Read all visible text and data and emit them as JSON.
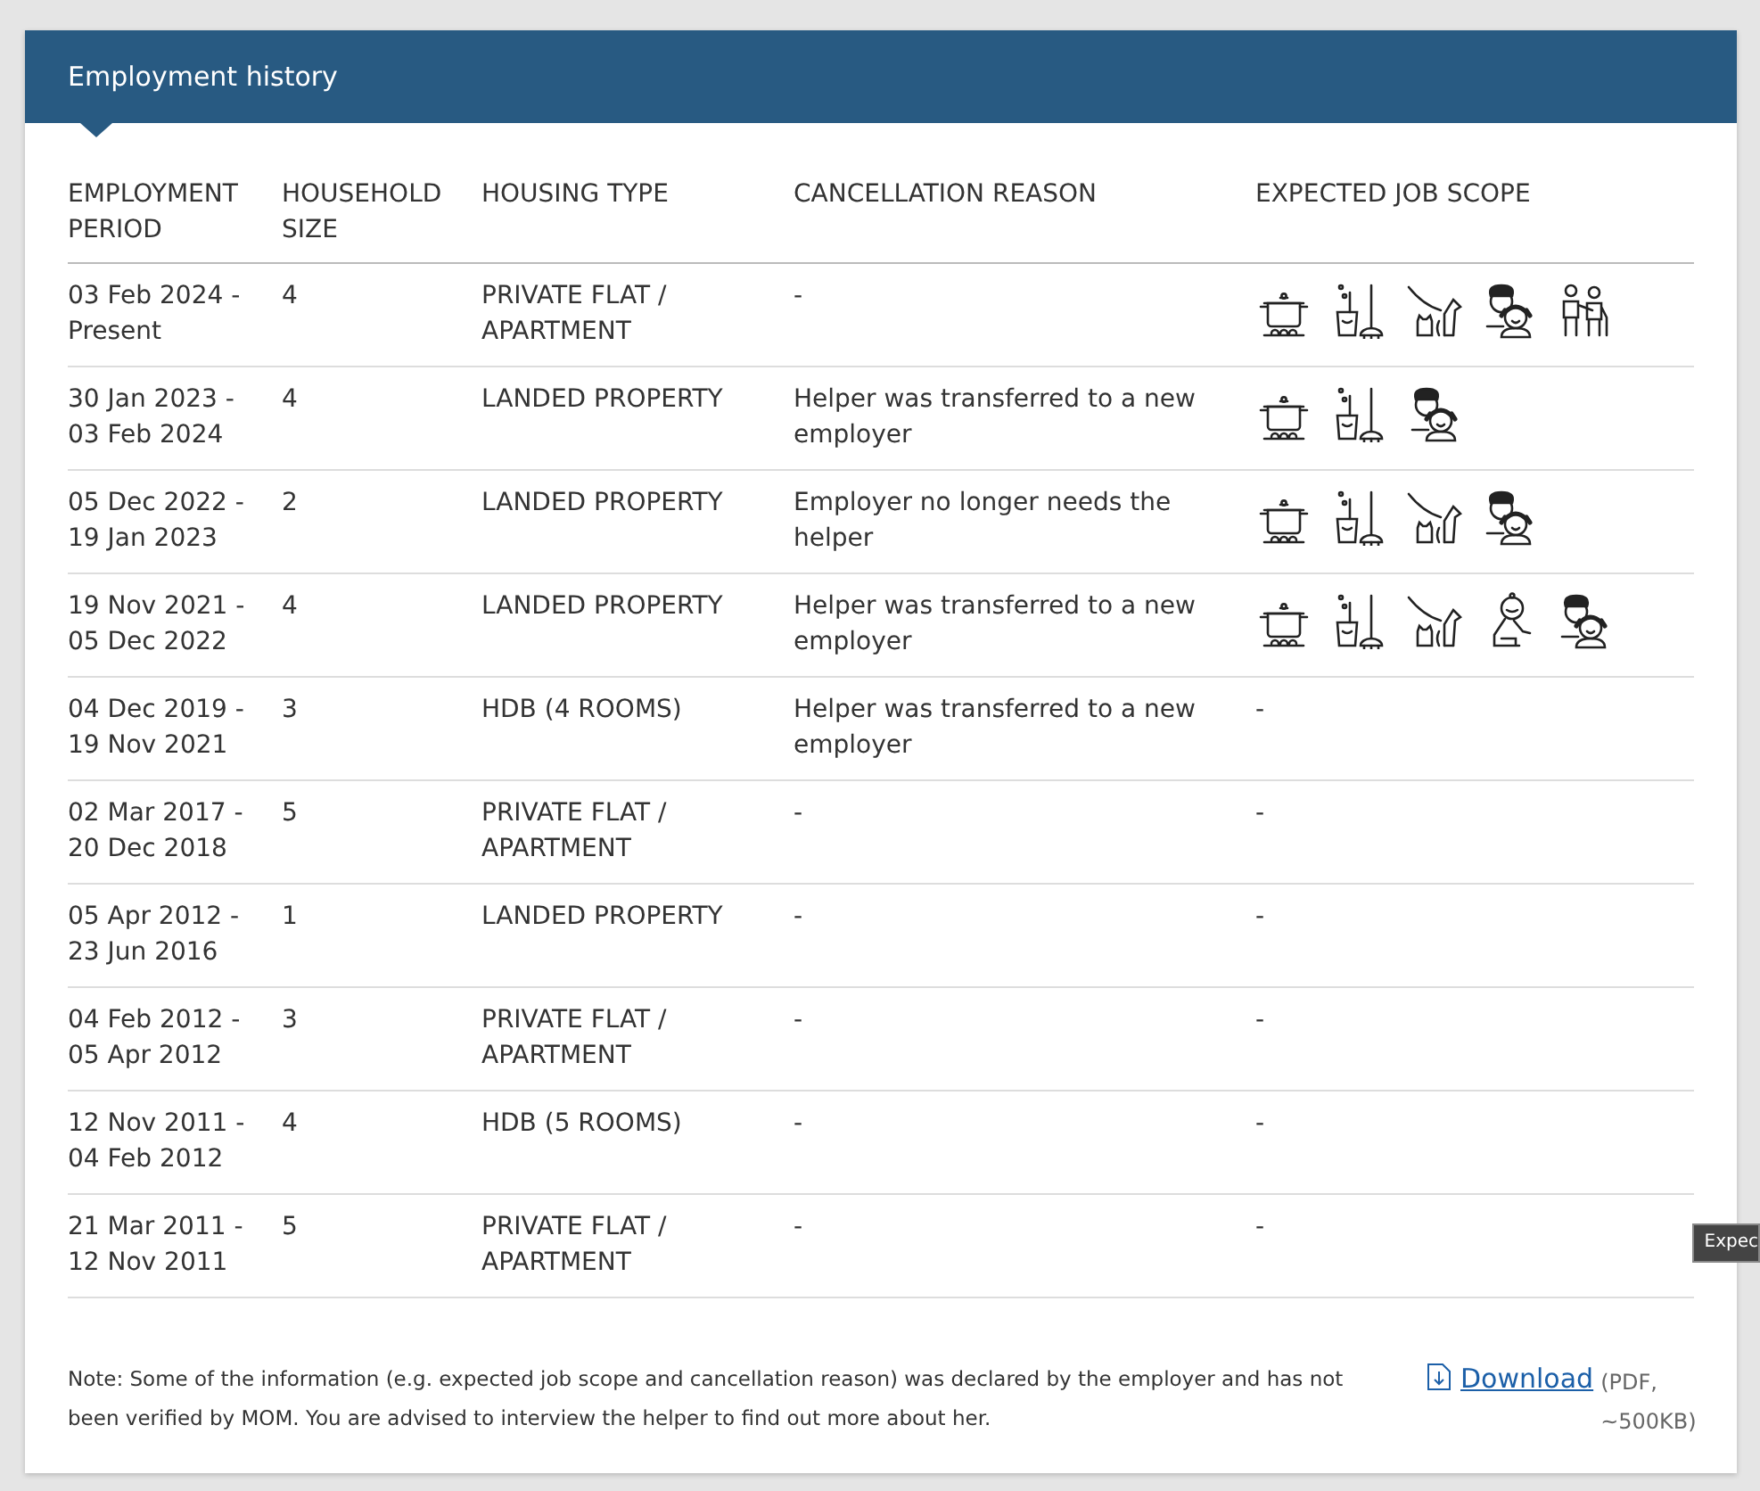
{
  "panel": {
    "title": "Employment history"
  },
  "table": {
    "columns": [
      "EMPLOYMENT PERIOD",
      "HOUSEHOLD SIZE",
      "HOUSING TYPE",
      "CANCELLATION REASON",
      "EXPECTED JOB SCOPE"
    ],
    "rows": [
      {
        "period": "03 Feb 2024 - Present",
        "household_size": "4",
        "housing_type": "PRIVATE FLAT / APARTMENT",
        "cancellation_reason": "-",
        "job_scope": [
          {
            "kind": "cooking"
          },
          {
            "kind": "cleaning"
          },
          {
            "kind": "pets"
          },
          {
            "kind": "childcare"
          },
          {
            "kind": "eldercare"
          }
        ]
      },
      {
        "period": "30 Jan 2023 - 03 Feb 2024",
        "household_size": "4",
        "housing_type": "LANDED PROPERTY",
        "cancellation_reason": "Helper was transferred to a new employer",
        "job_scope": [
          {
            "kind": "cooking"
          },
          {
            "kind": "cleaning"
          },
          {
            "kind": "childcare"
          }
        ]
      },
      {
        "period": "05 Dec 2022 - 19 Jan 2023",
        "household_size": "2",
        "housing_type": "LANDED PROPERTY",
        "cancellation_reason": "Employer no longer needs the helper",
        "job_scope": [
          {
            "kind": "cooking"
          },
          {
            "kind": "cleaning"
          },
          {
            "kind": "pets"
          },
          {
            "kind": "childcare"
          }
        ]
      },
      {
        "period": "19 Nov 2021 - 05 Dec 2022",
        "household_size": "4",
        "housing_type": "LANDED PROPERTY",
        "cancellation_reason": "Helper was transferred to a new employer",
        "job_scope": [
          {
            "kind": "cooking"
          },
          {
            "kind": "cleaning"
          },
          {
            "kind": "pets"
          },
          {
            "kind": "infant"
          },
          {
            "kind": "childcare"
          }
        ]
      },
      {
        "period": "04 Dec 2019 - 19 Nov 2021",
        "household_size": "3",
        "housing_type": "HDB (4 ROOMS)",
        "cancellation_reason": "Helper was transferred to a new employer",
        "job_scope_text": "-"
      },
      {
        "period": "02 Mar 2017 - 20 Dec 2018",
        "household_size": "5",
        "housing_type": "PRIVATE FLAT / APARTMENT",
        "cancellation_reason": "-",
        "job_scope_text": "-"
      },
      {
        "period": "05 Apr 2012 - 23 Jun 2016",
        "household_size": "1",
        "housing_type": "LANDED PROPERTY",
        "cancellation_reason": "-",
        "job_scope_text": "-"
      },
      {
        "period": "04 Feb 2012 - 05 Apr 2012",
        "household_size": "3",
        "housing_type": "PRIVATE FLAT / APARTMENT",
        "cancellation_reason": "-",
        "job_scope_text": "-"
      },
      {
        "period": "12 Nov 2011 - 04 Feb 2012",
        "household_size": "4",
        "housing_type": "HDB (5 ROOMS)",
        "cancellation_reason": "-",
        "job_scope_text": "-"
      },
      {
        "period": "21 Mar 2011 - 12 Nov 2011",
        "household_size": "5",
        "housing_type": "PRIVATE FLAT / APARTMENT",
        "cancellation_reason": "-",
        "job_scope_text": "-"
      }
    ]
  },
  "note": "Note: Some of the information (e.g. expected job scope and cancellation reason) was declared by the employer and has not been verified by MOM. You are advised to interview the helper to find out more about her.",
  "download": {
    "label": "Download",
    "info": "(PDF, ~500KB)"
  },
  "tooltip": "Expec"
}
